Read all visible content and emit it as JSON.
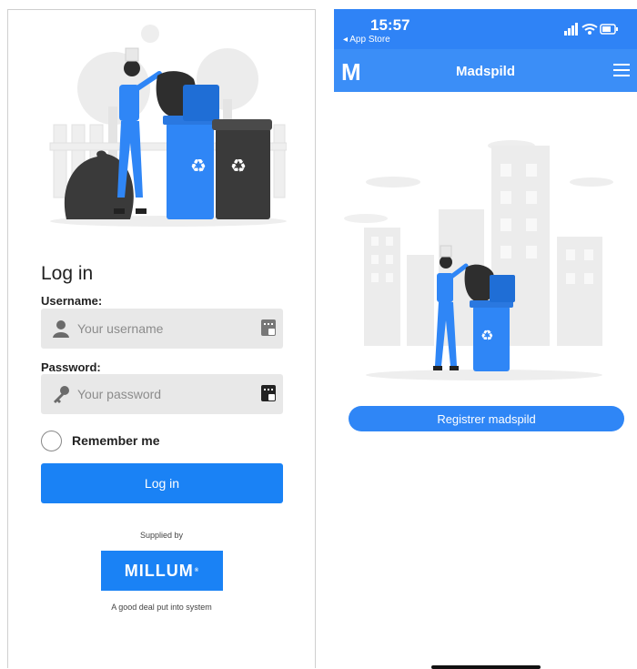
{
  "login": {
    "title": "Log in",
    "username_label": "Username:",
    "username_placeholder": "Your username",
    "password_label": "Password:",
    "password_placeholder": "Your password",
    "remember_label": "Remember me",
    "login_button": "Log in",
    "supplied_by": "Supplied by",
    "brand": "MILLUM",
    "tagline": "A good deal put into system"
  },
  "phone": {
    "time": "15:57",
    "back_label": "◂ App Store",
    "app_title": "Madspild",
    "logo_letter": "M",
    "register_button": "Registrer madspild"
  },
  "colors": {
    "accent": "#1a82f5",
    "navbar": "#3b8ef7",
    "field_bg": "#e8e8e8"
  },
  "icons": [
    "user-icon",
    "keypad-icon",
    "key-icon",
    "hamburger-menu-icon",
    "signal-icon",
    "wifi-icon",
    "battery-icon",
    "recycle-icon"
  ]
}
